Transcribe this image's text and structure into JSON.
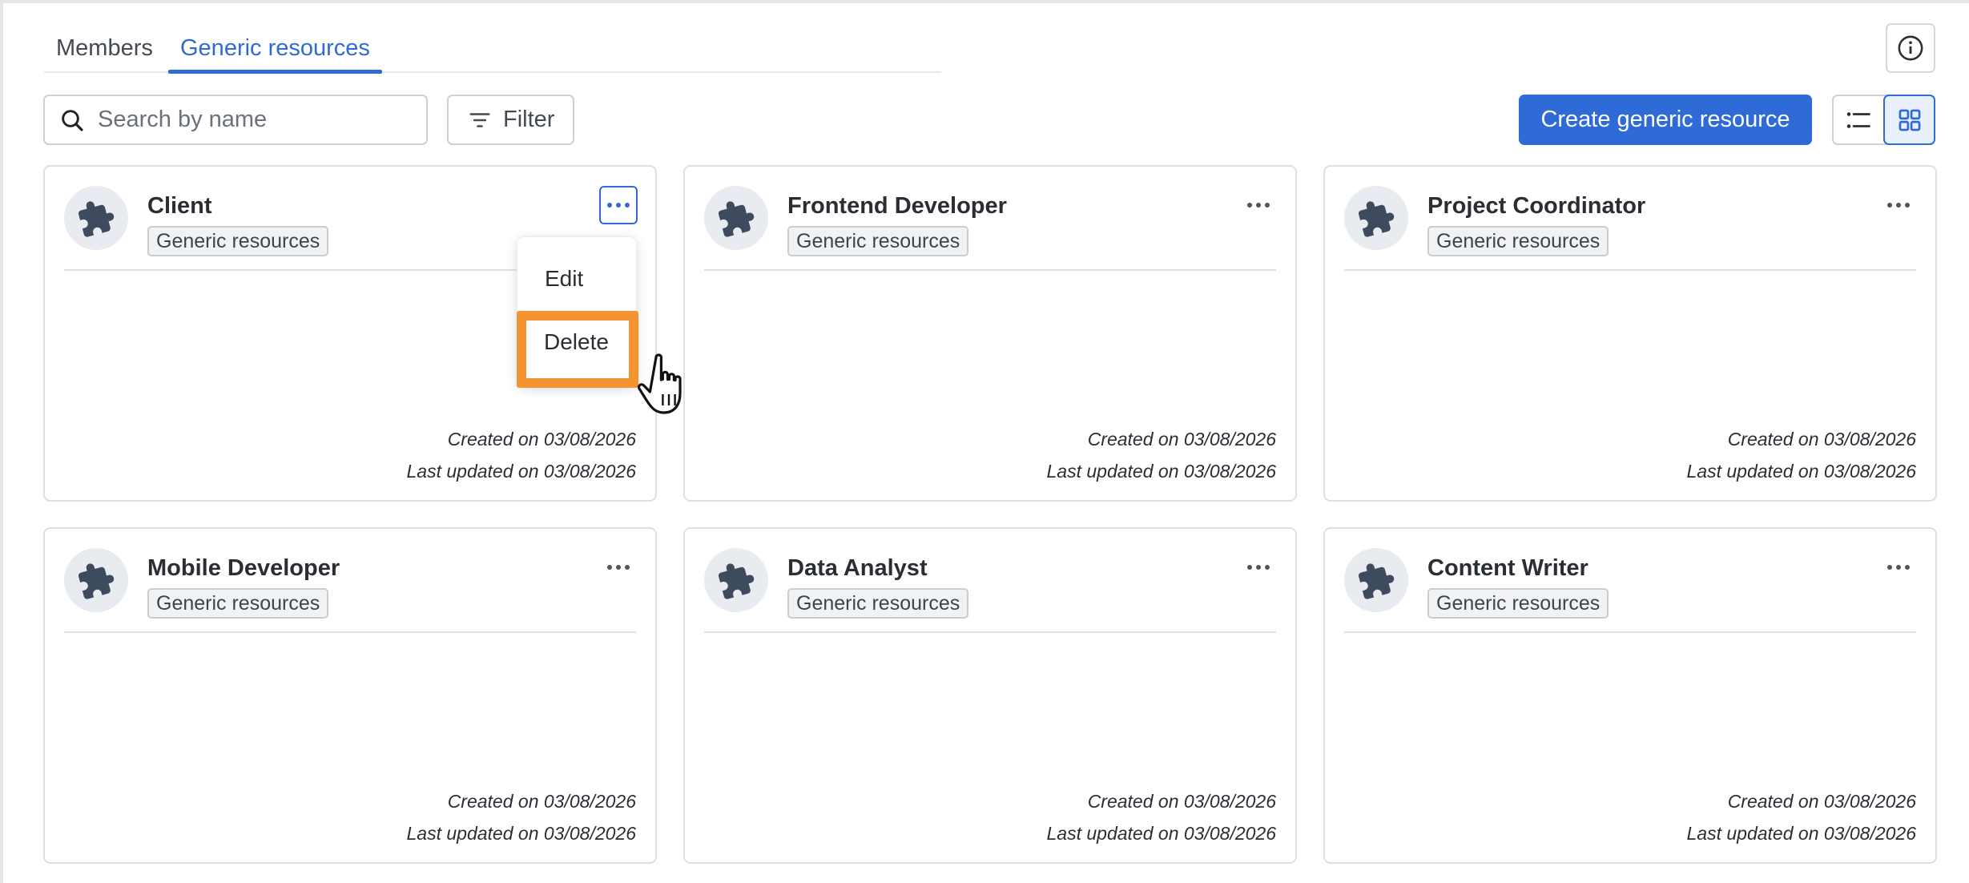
{
  "tabs": [
    {
      "label": "Members",
      "active": false
    },
    {
      "label": "Generic resources",
      "active": true
    }
  ],
  "search": {
    "placeholder": "Search by name",
    "value": ""
  },
  "toolbar": {
    "filter_label": "Filter",
    "create_label": "Create generic resource",
    "view_mode": "grid"
  },
  "cards": [
    {
      "name": "Client",
      "tag": "Generic resources",
      "created": "Created on 03/08/2026",
      "updated": "Last updated on 03/08/2026",
      "menu_open": true
    },
    {
      "name": "Frontend Developer",
      "tag": "Generic resources",
      "created": "Created on 03/08/2026",
      "updated": "Last updated on 03/08/2026"
    },
    {
      "name": "Project Coordinator",
      "tag": "Generic resources",
      "created": "Created on 03/08/2026",
      "updated": "Last updated on 03/08/2026"
    },
    {
      "name": "Mobile Developer",
      "tag": "Generic resources",
      "created": "Created on 03/08/2026",
      "updated": "Last updated on 03/08/2026"
    },
    {
      "name": "Data Analyst",
      "tag": "Generic resources",
      "created": "Created on 03/08/2026",
      "updated": "Last updated on 03/08/2026"
    },
    {
      "name": "Content Writer",
      "tag": "Generic resources",
      "created": "Created on 03/08/2026",
      "updated": "Last updated on 03/08/2026"
    }
  ],
  "menu": {
    "edit_label": "Edit",
    "delete_label": "Delete",
    "highlighted": "Delete"
  },
  "colors": {
    "accent": "#2f6bd6",
    "highlight": "#f39332",
    "icon": "#3e4a5e"
  },
  "icons": [
    "search-icon",
    "filter-icon",
    "info-icon",
    "list-view-icon",
    "grid-view-icon",
    "puzzle-icon",
    "more-icon",
    "hand-pointer-icon"
  ]
}
